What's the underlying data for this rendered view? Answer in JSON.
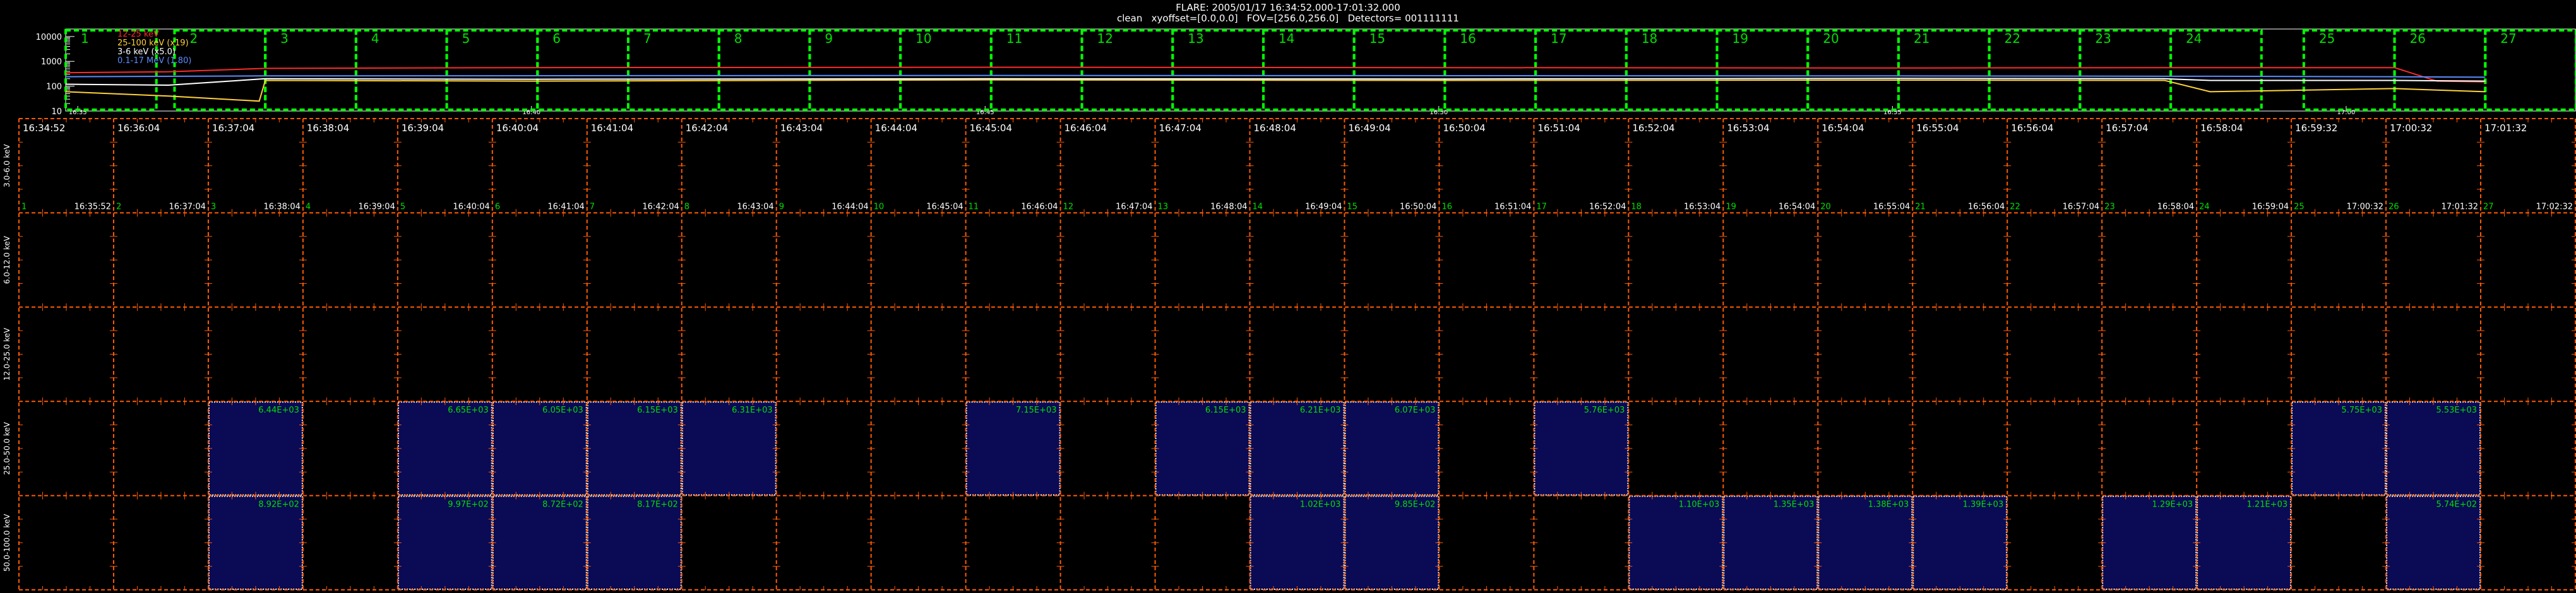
{
  "header": {
    "line1": "FLARE: 2005/01/17 16:34:52.000-17:01:32.000",
    "line2": "clean   xyoffset=[0.0,0.0]   FOV=[256.0,256.0]   Detectors= 001111111"
  },
  "colors": {
    "frame": "#ff5a00",
    "interval_box": "#00ff00",
    "image_bg": "#0a0a55",
    "image_border": "#ffffff",
    "text": "#ffffff",
    "max_label": "#00e000",
    "interval_number": "#00e000"
  },
  "chart_data": [
    {
      "type": "line",
      "title": "",
      "ylabel": "",
      "yscale": "log",
      "ylim": [
        10,
        20000
      ],
      "ytick_labels": [
        "10000",
        "1000",
        "100",
        "10"
      ],
      "xtick_labels": [
        "16:35",
        "16:40",
        "16:45",
        "16:50",
        "16:55",
        "17:00"
      ],
      "series": [
        {
          "name": "12-25 keV",
          "color": "#ff2a2a",
          "x": [
            "16:34:52",
            "16:36:00",
            "16:37:04",
            "16:40:00",
            "16:45:00",
            "16:50:00",
            "16:55:00",
            "16:58:00",
            "16:58:30",
            "17:00:32",
            "17:01:00",
            "17:01:32"
          ],
          "values": [
            350,
            380,
            520,
            560,
            580,
            560,
            540,
            560,
            560,
            560,
            160,
            150
          ]
        },
        {
          "name": "25-100 keV (x19)",
          "color": "#ffd23a",
          "x": [
            "16:34:52",
            "16:36:00",
            "16:37:00",
            "16:37:04",
            "16:40:00",
            "16:45:00",
            "16:50:00",
            "16:55:00",
            "16:58:00",
            "16:58:30",
            "17:00:32",
            "17:01:00",
            "17:01:32"
          ],
          "values": [
            60,
            40,
            25,
            170,
            160,
            180,
            170,
            175,
            170,
            60,
            80,
            70,
            60
          ]
        },
        {
          "name": "3-6 keV (x5.0)",
          "color": "#ffffff",
          "x": [
            "16:34:52",
            "16:36:00",
            "16:37:04",
            "16:40:00",
            "16:45:00",
            "16:50:00",
            "16:55:00",
            "16:58:00",
            "16:58:30",
            "17:00:32",
            "17:01:32"
          ],
          "values": [
            120,
            110,
            200,
            190,
            200,
            195,
            205,
            200,
            170,
            170,
            160
          ]
        },
        {
          "name": "0.1-17 MeV (1.80)",
          "color": "#5a8cff",
          "x": [
            "16:34:52",
            "16:37:04",
            "16:45:00",
            "16:55:00",
            "16:58:30",
            "17:00:32",
            "17:01:32"
          ],
          "values": [
            240,
            260,
            270,
            260,
            250,
            240,
            230
          ]
        }
      ],
      "legend": [
        "12-25 keV",
        "25-100 keV (x19)",
        "3-6 keV (x5.0)",
        "0.1-17 MeV (1.80)"
      ],
      "legend_position": "top-left",
      "intervals": [
        "1",
        "2",
        "3",
        "4",
        "5",
        "6",
        "7",
        "8",
        "9",
        "10",
        "11",
        "12",
        "13",
        "14",
        "15",
        "16",
        "17",
        "18",
        "19",
        "20",
        "21",
        "22",
        "23",
        "24",
        "25",
        "26",
        "27"
      ]
    },
    {
      "type": "heatmap",
      "title": "",
      "start_labels": [
        "16:34:52",
        "16:36:04",
        "16:37:04",
        "16:38:04",
        "16:39:04",
        "16:40:04",
        "16:41:04",
        "16:42:04",
        "16:43:04",
        "16:44:04",
        "16:45:04",
        "16:46:04",
        "16:47:04",
        "16:48:04",
        "16:49:04",
        "16:50:04",
        "16:51:04",
        "16:52:04",
        "16:53:04",
        "16:54:04",
        "16:55:04",
        "16:56:04",
        "16:57:04",
        "16:58:04",
        "16:59:32",
        "17:00:32",
        "17:01:32"
      ],
      "end_labels": [
        "16:35:52",
        "16:37:04",
        "16:38:04",
        "16:39:04",
        "16:40:04",
        "16:41:04",
        "16:42:04",
        "16:43:04",
        "16:44:04",
        "16:45:04",
        "16:46:04",
        "16:47:04",
        "16:48:04",
        "16:49:04",
        "16:50:04",
        "16:51:04",
        "16:52:04",
        "16:53:04",
        "16:54:04",
        "16:55:04",
        "16:56:04",
        "16:57:04",
        "16:58:04",
        "16:59:04",
        "17:00:32",
        "17:01:32",
        "17:02:32"
      ],
      "interval_numbers": [
        "1",
        "2",
        "3",
        "4",
        "5",
        "6",
        "7",
        "8",
        "9",
        "10",
        "11",
        "12",
        "13",
        "14",
        "15",
        "16",
        "17",
        "18",
        "19",
        "20",
        "21",
        "22",
        "23",
        "24",
        "25",
        "26",
        "27"
      ],
      "energy_bands": [
        "3.0-6.0 keV",
        "6.0-12.0 keV",
        "12.0-25.0 keV",
        "25.0-50.0 keV",
        "50.0-100.0 keV"
      ],
      "images": [
        {
          "band": 3,
          "col": 2,
          "max": "6.44E+03"
        },
        {
          "band": 3,
          "col": 4,
          "max": "6.65E+03"
        },
        {
          "band": 3,
          "col": 5,
          "max": "6.05E+03"
        },
        {
          "band": 3,
          "col": 6,
          "max": "6.15E+03"
        },
        {
          "band": 3,
          "col": 7,
          "max": "6.31E+03"
        },
        {
          "band": 3,
          "col": 10,
          "max": "7.15E+03"
        },
        {
          "band": 3,
          "col": 12,
          "max": "6.15E+03"
        },
        {
          "band": 3,
          "col": 13,
          "max": "6.21E+03"
        },
        {
          "band": 3,
          "col": 14,
          "max": "6.07E+03"
        },
        {
          "band": 3,
          "col": 16,
          "max": "5.76E+03"
        },
        {
          "band": 3,
          "col": 24,
          "max": "5.75E+03"
        },
        {
          "band": 3,
          "col": 25,
          "max": "5.53E+03"
        },
        {
          "band": 4,
          "col": 2,
          "max": "8.92E+02"
        },
        {
          "band": 4,
          "col": 4,
          "max": "9.97E+02"
        },
        {
          "band": 4,
          "col": 5,
          "max": "8.72E+02"
        },
        {
          "band": 4,
          "col": 6,
          "max": "8.17E+02"
        },
        {
          "band": 4,
          "col": 13,
          "max": "1.02E+03"
        },
        {
          "band": 4,
          "col": 14,
          "max": "9.85E+02"
        },
        {
          "band": 4,
          "col": 17,
          "max": "1.10E+03"
        },
        {
          "band": 4,
          "col": 18,
          "max": "1.35E+03"
        },
        {
          "band": 4,
          "col": 19,
          "max": "1.38E+03"
        },
        {
          "band": 4,
          "col": 20,
          "max": "1.39E+03"
        },
        {
          "band": 4,
          "col": 22,
          "max": "1.29E+03"
        },
        {
          "band": 4,
          "col": 23,
          "max": "1.21E+03"
        },
        {
          "band": 4,
          "col": 25,
          "max": "5.74E+02"
        }
      ]
    }
  ]
}
